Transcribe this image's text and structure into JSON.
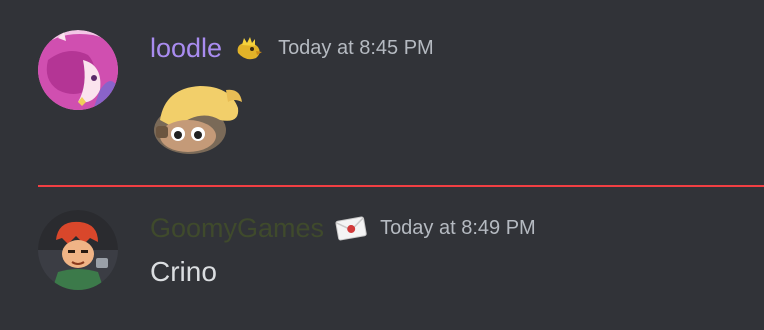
{
  "messages": [
    {
      "username": "loodle",
      "role_icon": "crowned-bird-icon",
      "timestamp": "Today at 8:45 PM",
      "avatar_icon": "pink-hair-anime-avatar",
      "sticker_icon": "blonde-plush-doll-sticker",
      "username_color": "#a98cf0"
    },
    {
      "username": "GoomyGames",
      "role_icon": "envelope-icon",
      "timestamp": "Today at 8:49 PM",
      "avatar_icon": "red-hair-cartoon-avatar",
      "content": "Crino",
      "username_color": "#3f4a2c"
    }
  ],
  "divider": {
    "color": "#f23f43"
  }
}
